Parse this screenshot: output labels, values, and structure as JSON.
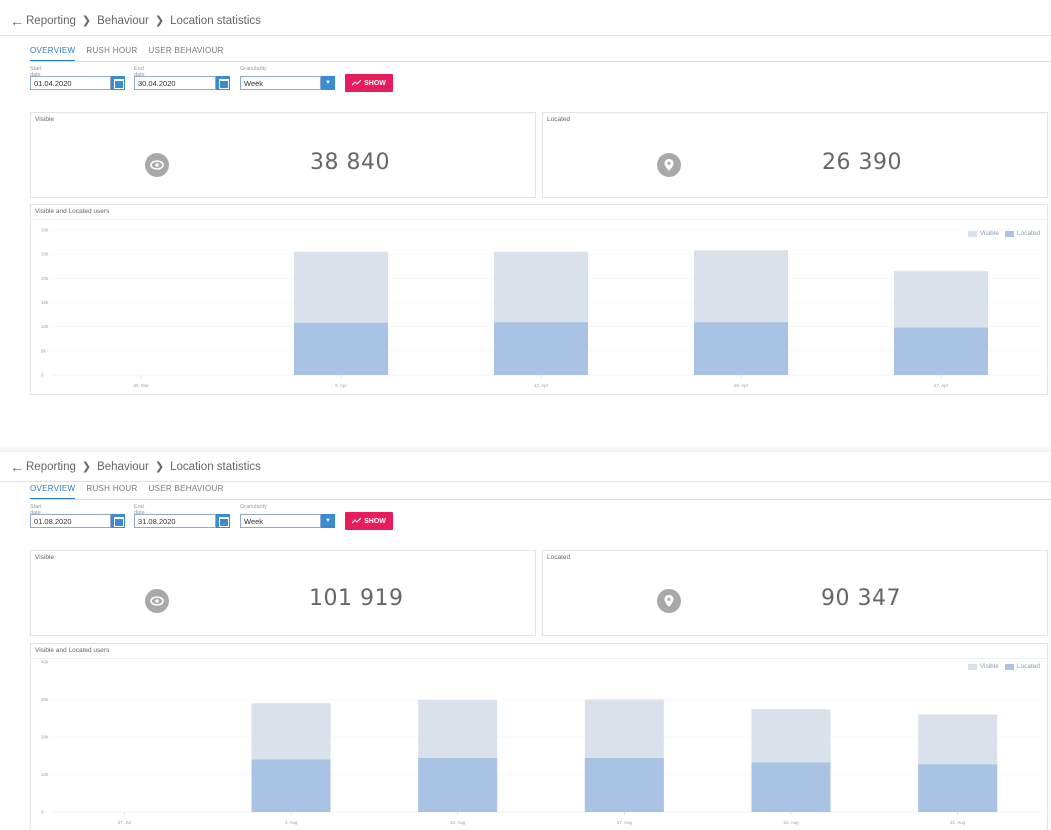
{
  "panels": [
    {
      "breadcrumb": [
        "Reporting",
        "Behaviour",
        "Location statistics"
      ],
      "tabs": [
        "OVERVIEW",
        "RUSH HOUR",
        "USER BEHAVIOUR"
      ],
      "active_tab": 0,
      "filters": {
        "start_label": "Start date",
        "start_value": "01.04.2020",
        "end_label": "End date",
        "end_value": "30.04.2020",
        "granularity_label": "Granularity",
        "granularity_value": "Week",
        "show_label": "SHOW"
      },
      "visible": {
        "title": "Visible",
        "value": "38 840"
      },
      "located": {
        "title": "Located",
        "value": "26 390"
      },
      "chart": {
        "title": "Visible and Located users",
        "legend": [
          "Visible",
          "Located"
        ]
      }
    },
    {
      "breadcrumb": [
        "Reporting",
        "Behaviour",
        "Location statistics"
      ],
      "tabs": [
        "OVERVIEW",
        "RUSH HOUR",
        "USER BEHAVIOUR"
      ],
      "active_tab": 0,
      "filters": {
        "start_label": "Start date",
        "start_value": "01.08.2020",
        "end_label": "End date",
        "end_value": "31.08.2020",
        "granularity_label": "Granularity",
        "granularity_value": "Week",
        "show_label": "SHOW"
      },
      "visible": {
        "title": "Visible",
        "value": "101 919"
      },
      "located": {
        "title": "Located",
        "value": "90 347"
      },
      "chart": {
        "title": "Visible and Located users",
        "legend": [
          "Visible",
          "Located"
        ]
      }
    }
  ],
  "colors": {
    "visible": "#d9e1eb",
    "located": "#a8c3e3",
    "accent": "#2b7bc4",
    "show_button": "#e81c5c"
  },
  "chart_data": [
    {
      "type": "bar",
      "stacked": false,
      "categories": [
        "30. Mar",
        "6. Apr",
        "13. Apr",
        "20. Apr",
        "27. Apr"
      ],
      "series": [
        {
          "name": "Visible",
          "values": [
            0,
            25500,
            25500,
            25800,
            21500
          ]
        },
        {
          "name": "Located",
          "values": [
            0,
            10800,
            10900,
            10900,
            9800
          ]
        }
      ],
      "y_ticks": [
        "0",
        "5k",
        "10k",
        "15k",
        "20k",
        "25k",
        "30k"
      ],
      "ylim": [
        0,
        30000
      ],
      "legend_position": "top-right",
      "grid": true
    },
    {
      "type": "bar",
      "stacked": false,
      "categories": [
        "27. Jul",
        "3. Aug",
        "10. Aug",
        "17. Aug",
        "24. Aug",
        "31. Aug"
      ],
      "series": [
        {
          "name": "Visible",
          "values": [
            0,
            29000,
            29900,
            30000,
            27400,
            26000
          ]
        },
        {
          "name": "Located",
          "values": [
            0,
            14000,
            14400,
            14400,
            13200,
            12700
          ]
        }
      ],
      "y_ticks": [
        "0",
        "10k",
        "20k",
        "30k",
        "40k"
      ],
      "ylim": [
        0,
        40000
      ],
      "legend_position": "top-right",
      "grid": true
    }
  ]
}
